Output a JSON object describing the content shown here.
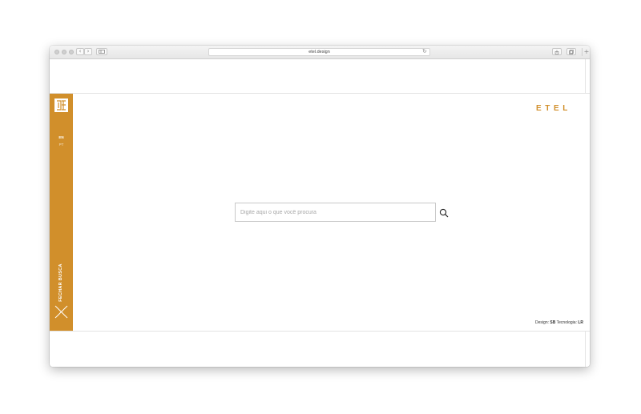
{
  "browser": {
    "url": "etel.design",
    "back_icon": "chevron-left-icon",
    "forward_icon": "chevron-right-icon",
    "sidebar_toggle_icon": "sidebar-icon",
    "reload_icon": "reload-icon",
    "share_icon": "share-icon",
    "tabs_icon": "tabs-icon",
    "new_tab_icon": "plus-icon"
  },
  "sidebar": {
    "languages": [
      "EN",
      "PT"
    ],
    "close_label": "FECHAR BUSCA",
    "close_icon": "close-icon"
  },
  "header": {
    "brand": "ETEL"
  },
  "search": {
    "placeholder": "Digite aqui o que você procura",
    "value": "",
    "icon": "search-icon"
  },
  "footer": {
    "design_label": "Design:",
    "design_value": "SB",
    "tech_label": "Tecnologia:",
    "tech_value": "LR"
  },
  "colors": {
    "accent": "#d18f2b",
    "chrome": "#e9e9e9",
    "background": "#ffffff"
  }
}
